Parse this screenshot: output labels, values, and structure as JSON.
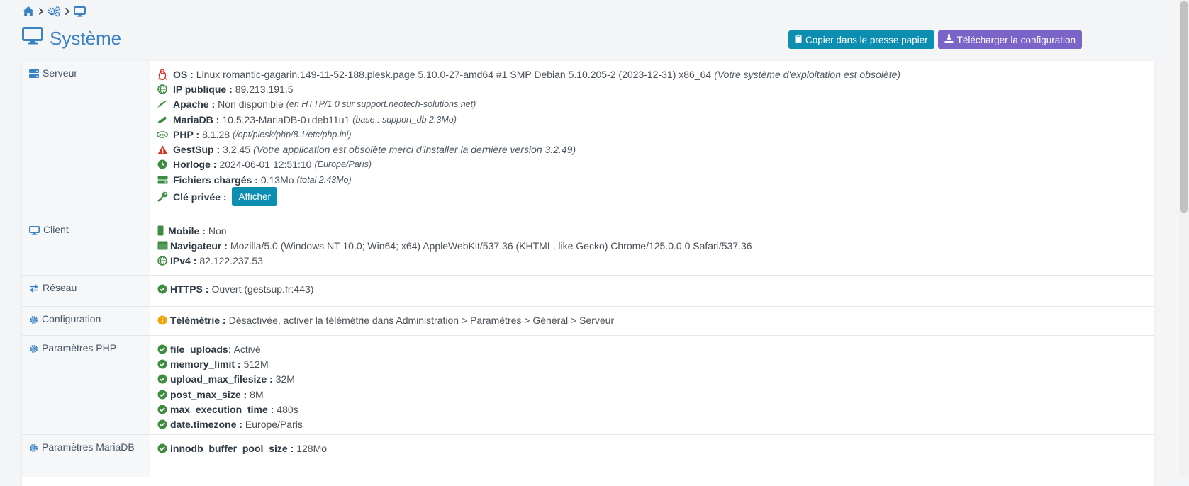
{
  "breadcrumb": {
    "items": [
      "home-icon",
      "cogs-icon",
      "desktop-icon"
    ]
  },
  "page": {
    "title": "Système"
  },
  "actions": {
    "copy_label": "Copier dans le presse papier",
    "download_label": "Télécharger la configuration"
  },
  "sections": {
    "server": {
      "label": "Serveur",
      "os": {
        "label": "OS :",
        "value": "Linux romantic-gagarin.149-11-52-188.plesk.page 5.10.0-27-amd64 #1 SMP Debian 5.10.205-2 (2023-12-31) x86_64",
        "note": "(Votre système d'exploitation est obsolète)"
      },
      "ip": {
        "label": "IP publique :",
        "value": "89.213.191.5"
      },
      "apache": {
        "label": "Apache :",
        "value": "Non disponible",
        "note": "(en HTTP/1.0 sur support.neotech-solutions.net)"
      },
      "mariadb": {
        "label": "MariaDB :",
        "value": "10.5.23-MariaDB-0+deb11u1",
        "note": "(base : support_db 2.3Mo)"
      },
      "php": {
        "label": "PHP :",
        "value": "8.1.28",
        "note": "(/opt/plesk/php/8.1/etc/php.ini)"
      },
      "gestsup": {
        "label": "GestSup :",
        "value": "3.2.45",
        "note": "(Votre application est obsolète merci d'installer la dernière version 3.2.49)"
      },
      "clock": {
        "label": "Horloge :",
        "value": "2024-06-01 12:51:10",
        "note": "(Europe/Paris)"
      },
      "files": {
        "label": "Fichiers chargés :",
        "value": "0.13Mo",
        "note": "(total 2.43Mo)"
      },
      "key": {
        "label": "Clé privée :",
        "button": "Afficher"
      }
    },
    "client": {
      "label": "Client",
      "mobile": {
        "label": "Mobile :",
        "value": "Non"
      },
      "browser": {
        "label": "Navigateur :",
        "value": "Mozilla/5.0 (Windows NT 10.0; Win64; x64) AppleWebKit/537.36 (KHTML, like Gecko) Chrome/125.0.0.0 Safari/537.36"
      },
      "ipv4": {
        "label": "IPv4 :",
        "value": "82.122.237.53"
      }
    },
    "network": {
      "label": "Réseau",
      "https": {
        "label": "HTTPS :",
        "value": "Ouvert (gestsup.fr:443)"
      }
    },
    "configuration": {
      "label": "Configuration",
      "telemetry": {
        "label": "Télémétrie :",
        "value": "Désactivée, activer la télémétrie dans Administration > Paramètres > Général > Serveur"
      }
    },
    "php_params": {
      "label": "Paramètres PHP",
      "items": [
        {
          "label": "file_uploads",
          "sep": " :",
          "value": "Activé"
        },
        {
          "label": "memory_limit :",
          "sep": "",
          "value": "512M"
        },
        {
          "label": "upload_max_filesize :",
          "sep": "",
          "value": "32M"
        },
        {
          "label": "post_max_size :",
          "sep": "",
          "value": "8M"
        },
        {
          "label": "max_execution_time :",
          "sep": "",
          "value": "480s"
        },
        {
          "label": "date.timezone :",
          "sep": "",
          "value": "Europe/Paris"
        }
      ]
    },
    "mariadb_params": {
      "label": "Paramètres MariaDB",
      "items": [
        {
          "label": "innodb_buffer_pool_size :",
          "value": "128Mo"
        }
      ]
    }
  },
  "colors": {
    "title_blue": "#3b82c4",
    "info_button": "#0b8eb0",
    "purple_button": "#7a64c8",
    "success_green": "#3d8c40",
    "warning_orange": "#f0a30a",
    "danger_red": "#d9362b"
  }
}
